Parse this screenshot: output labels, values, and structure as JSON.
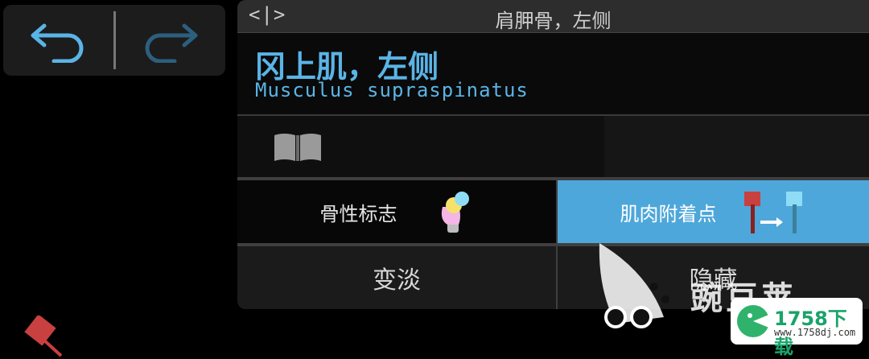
{
  "toolbar": {
    "undo_icon": "undo-arrow-icon",
    "redo_icon": "redo-arrow-icon",
    "undo_color": "#5ab4e6",
    "redo_color": "#2c5f7e"
  },
  "panel": {
    "nav_toggle": "<|>",
    "title": "肩胛骨，左侧",
    "muscle_name_cn": "冈上肌，左侧",
    "muscle_name_latin": "Musculus supraspinatus",
    "book_icon": "open-book-icon"
  },
  "tabs": [
    {
      "label": "骨性标志",
      "icon": "bone-landmark-icon",
      "active": false
    },
    {
      "label": "肌肉附着点",
      "icon": "muscle-attachment-icon",
      "active": true
    }
  ],
  "actions": {
    "fade_label": "变淡",
    "hide_label": "隐藏"
  },
  "colors": {
    "accent": "#4ea7da",
    "text_blue": "#5ab4e6",
    "marker_red": "#c94040"
  },
  "watermark": {
    "brand": "豌豆荚",
    "site": "1758下载",
    "url": "www.1758dj.com"
  }
}
